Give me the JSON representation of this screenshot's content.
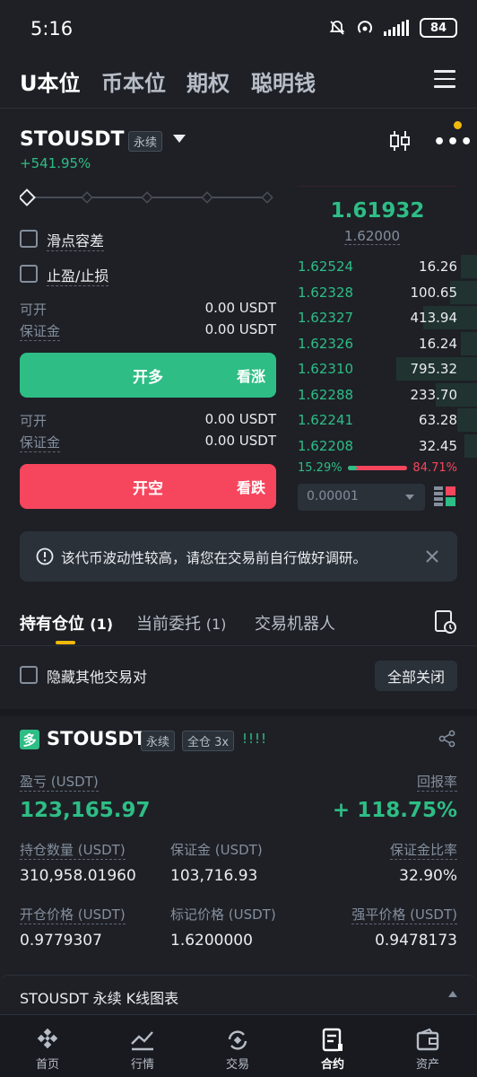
{
  "status": {
    "time": "5:16",
    "battery": "84"
  },
  "top_tabs": [
    "U本位",
    "币本位",
    "期权",
    "聪明钱"
  ],
  "header": {
    "symbol": "STOUSDT",
    "perp_tag": "永续",
    "change": "+541.95%"
  },
  "order_form": {
    "slippage_label": "滑点容差",
    "tpsl_label": "止盈/止损",
    "long": {
      "avail_label": "可开",
      "avail_value": "0.00 USDT",
      "margin_label": "保证金",
      "margin_value": "0.00 USDT",
      "button": "开多",
      "button_sub": "看涨"
    },
    "short": {
      "avail_label": "可开",
      "avail_value": "0.00 USDT",
      "margin_label": "保证金",
      "margin_value": "0.00 USDT",
      "button": "开空",
      "button_sub": "看跌"
    }
  },
  "order_book": {
    "last_price": "1.61932",
    "mark_price": "1.62000",
    "rows": [
      {
        "price": "1.62524",
        "qty": "16.26"
      },
      {
        "price": "1.62328",
        "qty": "100.65"
      },
      {
        "price": "1.62327",
        "qty": "413.94"
      },
      {
        "price": "1.62326",
        "qty": "16.24"
      },
      {
        "price": "1.62310",
        "qty": "795.32"
      },
      {
        "price": "1.62288",
        "qty": "233.70"
      },
      {
        "price": "1.62241",
        "qty": "63.28"
      },
      {
        "price": "1.62208",
        "qty": "32.45"
      }
    ],
    "buy_ratio": "15.29%",
    "sell_ratio": "84.71%",
    "buy_fraction": 0.1529,
    "precision": "0.00001"
  },
  "notice": {
    "text": "该代币波动性较高，请您在交易前自行做好调研。"
  },
  "positions_tabs": [
    {
      "label": "持有仓位",
      "count": "(1)"
    },
    {
      "label": "当前委托",
      "count": "(1)"
    },
    {
      "label": "交易机器人",
      "count": ""
    }
  ],
  "hide_others_label": "隐藏其他交易对",
  "close_all_label": "全部关闭",
  "position": {
    "side_badge": "多",
    "symbol": "STOUSDT",
    "perp_tag": "永续",
    "margin_tag": "全仓 3x",
    "signal": "!!!!",
    "pnl_label": "盈亏 (USDT)",
    "pnl_value": "123,165.97",
    "roi_label": "回报率",
    "roi_value": "+ 118.75%",
    "size_label": "持仓数量 (USDT)",
    "size_value": "310,958.01960",
    "margin_label": "保证金 (USDT)",
    "margin_value": "103,716.93",
    "margin_ratio_label": "保证金比率",
    "margin_ratio_value": "32.90%",
    "entry_label": "开仓价格 (USDT)",
    "entry_value": "0.9779307",
    "mark_label": "标记价格 (USDT)",
    "mark_value": "1.6200000",
    "liq_label": "强平价格 (USDT)",
    "liq_value": "0.9478173"
  },
  "kline_bar": {
    "label": "STOUSDT 永续 K线图表"
  },
  "bottom_nav": [
    "首页",
    "行情",
    "交易",
    "合约",
    "资产"
  ],
  "colors": {
    "green": "#2ebd85",
    "red": "#f6465d",
    "accent": "#f0b90b"
  }
}
